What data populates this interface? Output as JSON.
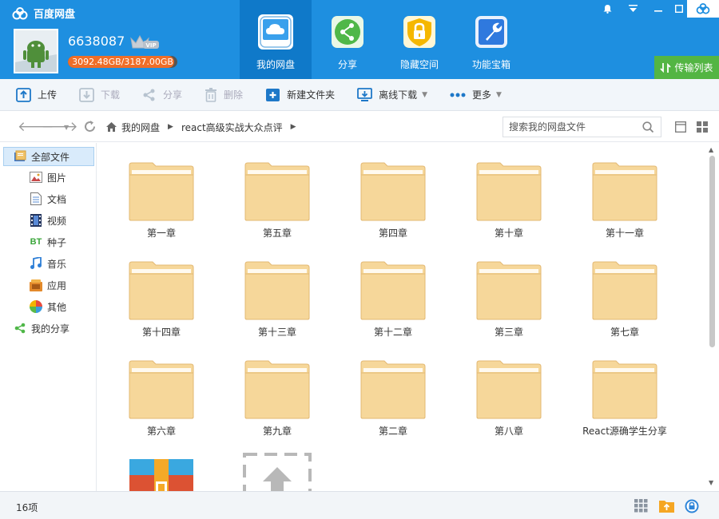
{
  "app": {
    "title": "百度网盘"
  },
  "user": {
    "name": "6638087",
    "vip_badge": "VIP",
    "quota": "3092.48GB/3187.00GB",
    "quota_fraction": 0.97
  },
  "nav_tabs": [
    {
      "label": "我的网盘",
      "icon": "cloud-icon",
      "active": true
    },
    {
      "label": "分享",
      "icon": "share-icon",
      "active": false
    },
    {
      "label": "隐藏空间",
      "icon": "lock-icon",
      "active": false
    },
    {
      "label": "功能宝箱",
      "icon": "wrench-icon",
      "active": false
    }
  ],
  "transfer_label": "传输列表",
  "toolbar": {
    "upload": "上传",
    "download": "下载",
    "share": "分享",
    "delete": "删除",
    "new_folder": "新建文件夹",
    "offline_download": "离线下载",
    "more": "更多"
  },
  "breadcrumb": [
    "我的网盘",
    "react高级实战大众点评"
  ],
  "search": {
    "placeholder": "搜索我的网盘文件"
  },
  "sidebar": {
    "items": [
      {
        "label": "全部文件",
        "icon": "all-files-icon"
      },
      {
        "label": "图片",
        "icon": "picture-icon"
      },
      {
        "label": "文档",
        "icon": "document-icon"
      },
      {
        "label": "视频",
        "icon": "video-icon"
      },
      {
        "label": "种子",
        "icon": "bt-icon",
        "icon_text": "BT"
      },
      {
        "label": "音乐",
        "icon": "music-icon"
      },
      {
        "label": "应用",
        "icon": "app-icon"
      },
      {
        "label": "其他",
        "icon": "other-icon"
      },
      {
        "label": "我的分享",
        "icon": "my-share-icon"
      }
    ]
  },
  "folders": [
    "第一章",
    "第五章",
    "第四章",
    "第十章",
    "第十一章",
    "第十四章",
    "第十三章",
    "第十二章",
    "第三章",
    "第七章",
    "第六章",
    "第九章",
    "第二章",
    "第八章",
    "React源确学生分享"
  ],
  "status": {
    "count": "16项"
  },
  "colors": {
    "header": "#1e8fe0",
    "active_tab": "#0f79c9",
    "folder": "#f6d79a",
    "quota_fill": "#f06e28",
    "transfer": "#53b543"
  }
}
